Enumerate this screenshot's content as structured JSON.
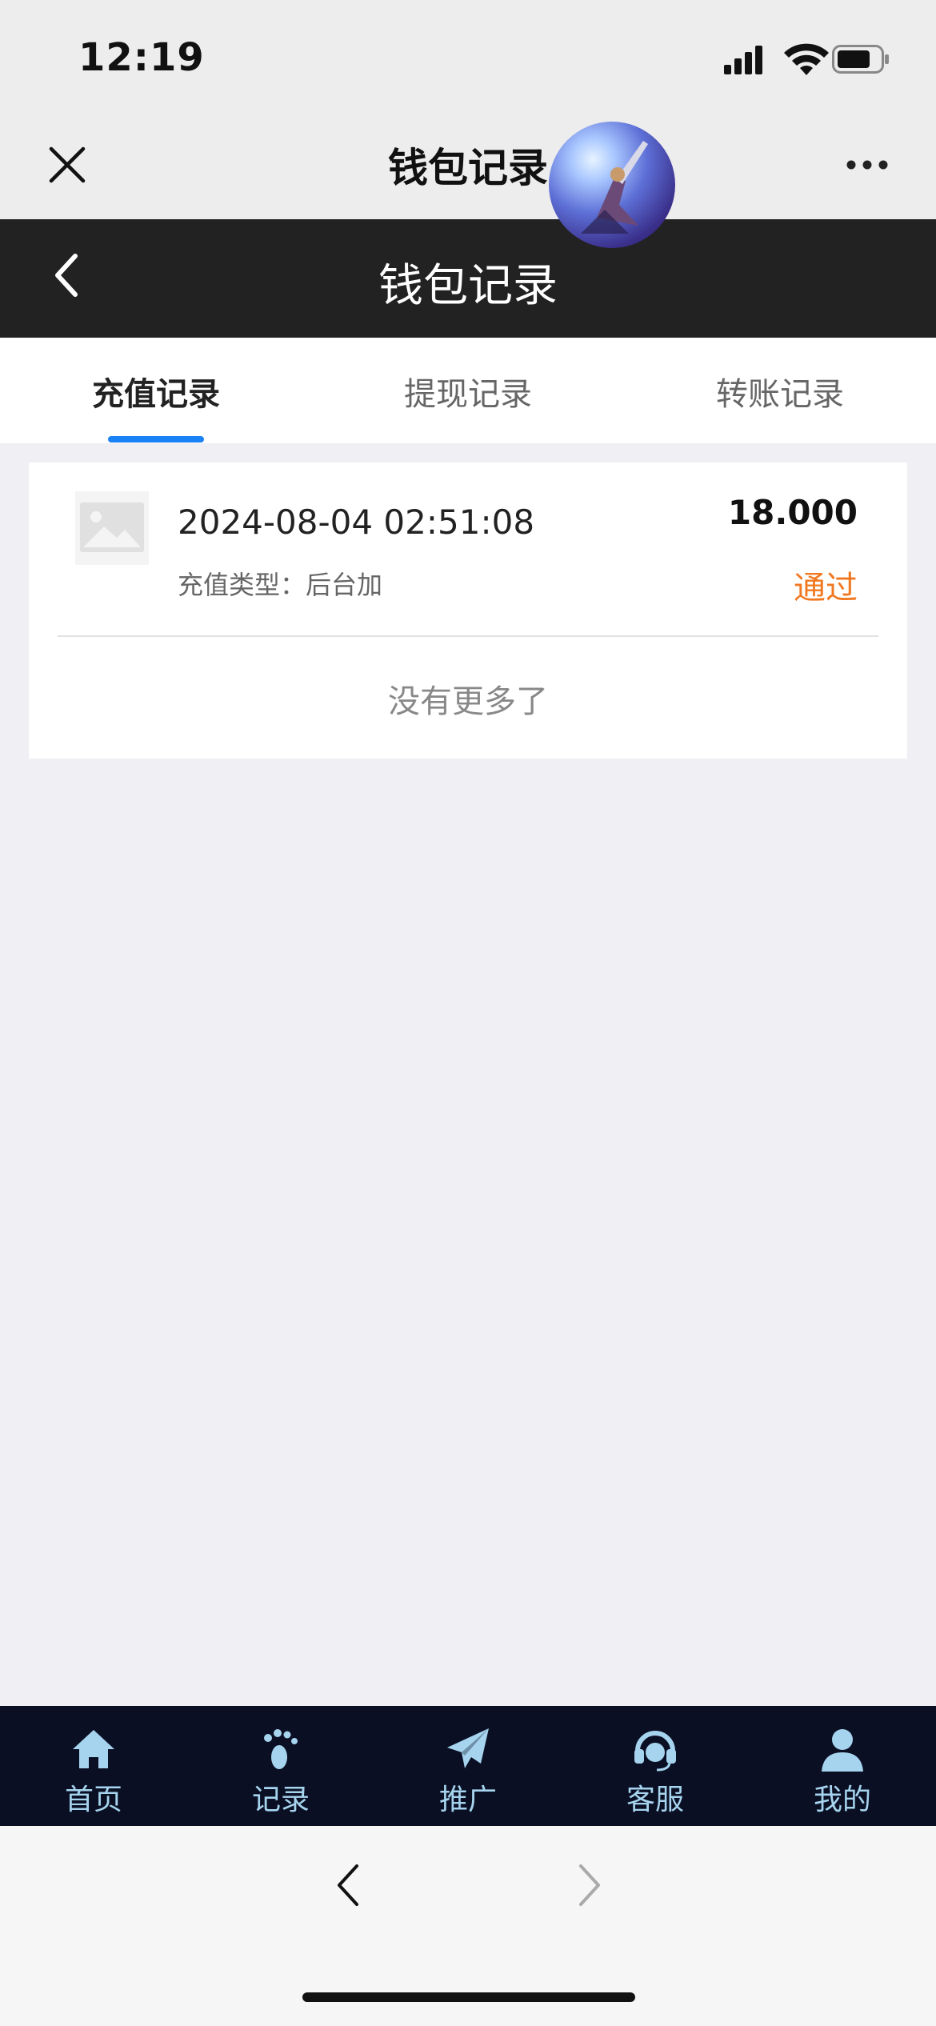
{
  "status_bar": {
    "time": "12:19"
  },
  "wechat_header": {
    "title": "钱包记录"
  },
  "app_header": {
    "title": "钱包记录"
  },
  "tabs": [
    {
      "label": "充值记录",
      "active": true
    },
    {
      "label": "提现记录",
      "active": false
    },
    {
      "label": "转账记录",
      "active": false
    }
  ],
  "records": [
    {
      "datetime": "2024-08-04 02:51:08",
      "type_label": "充值类型：后台加",
      "amount": "18.000",
      "status": "通过"
    }
  ],
  "no_more_text": "没有更多了",
  "bottom_nav": [
    {
      "label": "首页",
      "icon": "home-icon"
    },
    {
      "label": "记录",
      "icon": "footprint-icon"
    },
    {
      "label": "推广",
      "icon": "paper-plane-icon"
    },
    {
      "label": "客服",
      "icon": "headset-icon"
    },
    {
      "label": "我的",
      "icon": "user-icon"
    }
  ],
  "colors": {
    "accent": "#1a82f5",
    "status_pass": "#f07820",
    "nav_bg": "#0a0f24",
    "nav_text": "#a6d4ee",
    "app_header_bg": "#222222"
  }
}
